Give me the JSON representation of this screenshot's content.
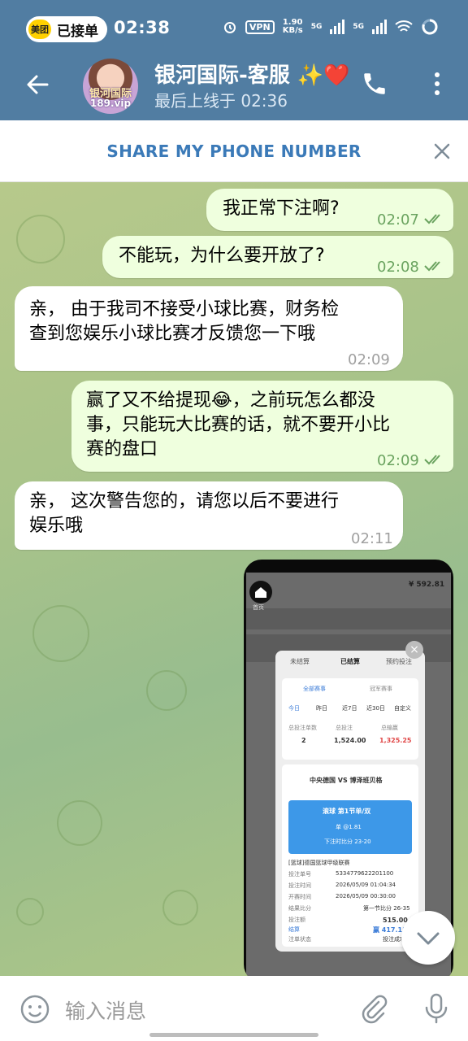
{
  "status_bar": {
    "app_badge": "美团",
    "app_label": "已接单",
    "time": "02:38",
    "vpn": "VPN",
    "speed_value": "1.90",
    "speed_unit": "KB/s",
    "sig1": "5G",
    "sig2": "5G"
  },
  "header": {
    "avatar_line1": "银河国际",
    "avatar_line2": "189.vip",
    "title": "银河国际-客服 ✨❤️",
    "subtitle": "最后上线于 02:36",
    "icons": [
      "back-arrow-icon",
      "phone-icon",
      "more-vert-icon"
    ]
  },
  "share_bar": {
    "label": "SHARE MY PHONE NUMBER",
    "close_icon": "close-icon"
  },
  "messages": [
    {
      "dir": "out",
      "lines": [
        "我正常下注啊?"
      ],
      "time": "02:07"
    },
    {
      "dir": "out",
      "lines": [
        "不能玩，为什么要开放了?"
      ],
      "time": "02:08"
    },
    {
      "dir": "in",
      "lines": [
        "亲， 由于我司不接受小球比赛，财务检",
        "查到您娱乐小球比赛才反馈您一下哦"
      ],
      "time": "02:09"
    },
    {
      "dir": "out",
      "lines": [
        "赢了又不给提现😂，之前玩怎么都没",
        "事，只能玩大比赛的话，就不要开小比",
        "赛的盘口"
      ],
      "time": "02:09"
    },
    {
      "dir": "in",
      "lines": [
        "亲， 这次警告您的，请您以后不要进行",
        "娱乐哦"
      ],
      "time": "02:11"
    }
  ],
  "screenshot": {
    "home_label": "首页",
    "balance": "¥ 592.81",
    "tabs": [
      "未结算",
      "已结算",
      "预约投注"
    ],
    "subtabs": [
      "全部赛事",
      "冠军赛事"
    ],
    "days": [
      "今日",
      "昨日",
      "近7日",
      "近30日",
      "自定义"
    ],
    "stats_labels": [
      "总投注单数",
      "总投注",
      "总输赢"
    ],
    "stats_values": [
      "2",
      "1,524.00",
      "1,325.25"
    ],
    "match": "中央德国  VS  博泽班贝格",
    "bet_title": "滚球 第1节单/双",
    "bet_pick": "单 @1.81",
    "bet_score": "下注时比分 23-20",
    "league": "[篮球]德国篮球甲级联赛",
    "rows": [
      [
        "投注单号",
        "5334779622201100"
      ],
      [
        "投注时间",
        "2026/05/09 01:04:34"
      ],
      [
        "开赛时间",
        "2026/05/09 00:30:00"
      ],
      [
        "结果比分",
        "第一节比分 26-35"
      ],
      [
        "投注额",
        "515.00 元"
      ],
      [
        "结算",
        "赢  417.15元"
      ],
      [
        "注单状态",
        "投注成功"
      ]
    ]
  },
  "input": {
    "placeholder": "输入消息",
    "icons": [
      "emoji-icon",
      "attach-icon",
      "mic-icon"
    ]
  },
  "colors": {
    "header": "#517da2",
    "out_bubble": "#efffde",
    "accent_text": "#3b7ab8",
    "time_out": "#6aa35f"
  }
}
